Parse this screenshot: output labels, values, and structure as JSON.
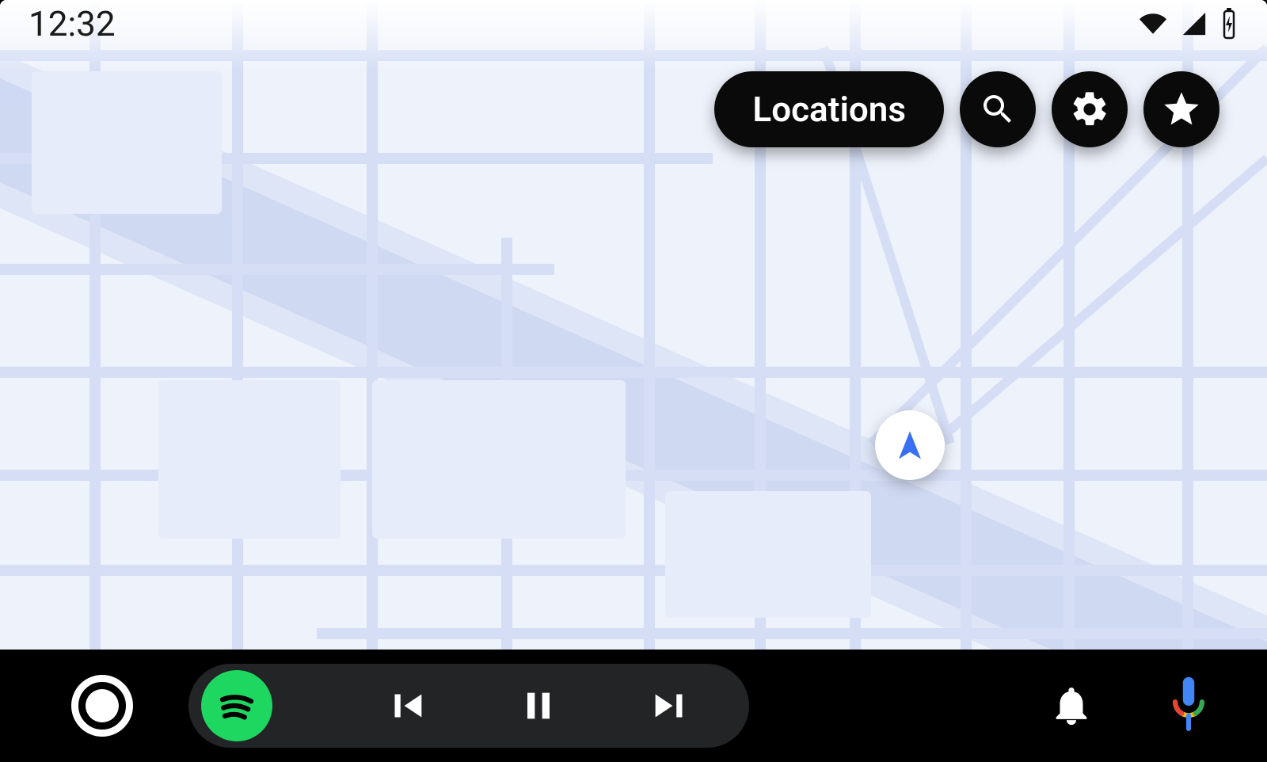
{
  "status": {
    "clock": "12:32",
    "wifi_icon": "wifi",
    "cell_icon": "cell-signal",
    "battery_icon": "battery-charging"
  },
  "map": {
    "actions": {
      "locations_label": "Locations",
      "search_icon": "search",
      "settings_icon": "settings",
      "favorites_icon": "star"
    },
    "marker": {
      "type": "current-location-arrow",
      "heading_deg": 0,
      "color": "#3a6ff2"
    }
  },
  "bottombar": {
    "home_icon": "launcher",
    "media": {
      "app_icon": "spotify",
      "prev_icon": "skip-previous",
      "playpause_icon": "pause",
      "next_icon": "skip-next"
    },
    "notifications_icon": "bell",
    "assistant_icon": "google-assistant-mic"
  },
  "colors": {
    "map_bg": "#eef2fb",
    "map_road": "#d5def5",
    "map_road2": "#c9d3ef",
    "accent_spotify": "#1ed760",
    "marker_blue": "#3a6ff2"
  }
}
